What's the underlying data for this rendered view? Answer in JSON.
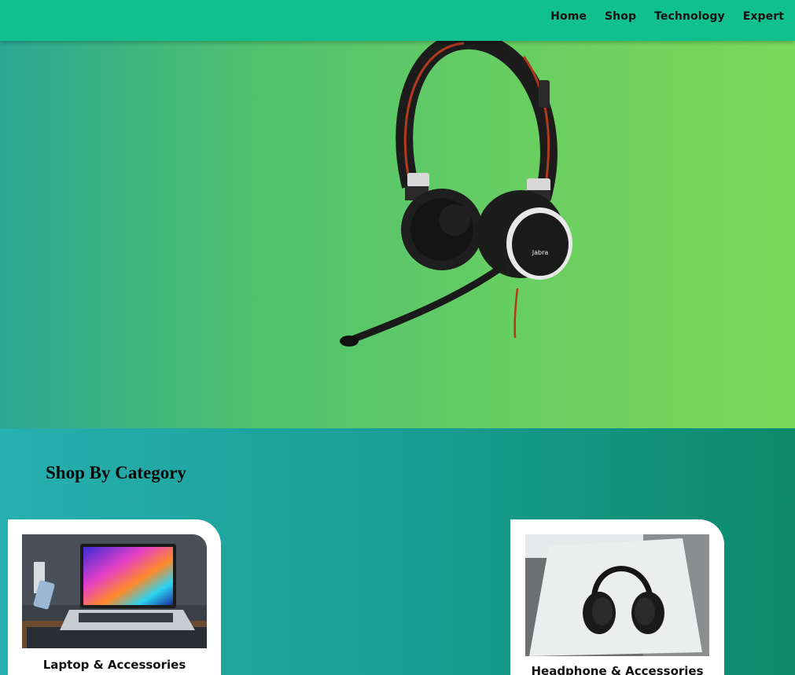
{
  "nav": {
    "items": [
      {
        "label": "Home"
      },
      {
        "label": "Shop"
      },
      {
        "label": "Technology"
      },
      {
        "label": "Expert"
      }
    ]
  },
  "hero": {
    "product_brand": "Jabra"
  },
  "categories": {
    "title": "Shop By Category",
    "items": [
      {
        "label": "Laptop & Accessories"
      },
      {
        "label": "Headphone & Accessories"
      }
    ]
  },
  "colors": {
    "topbar": "#10c08e",
    "hero_start": "#2aa893",
    "hero_end": "#7bd85a",
    "section_start": "#27b0b0",
    "section_end": "#0c8a6a"
  }
}
